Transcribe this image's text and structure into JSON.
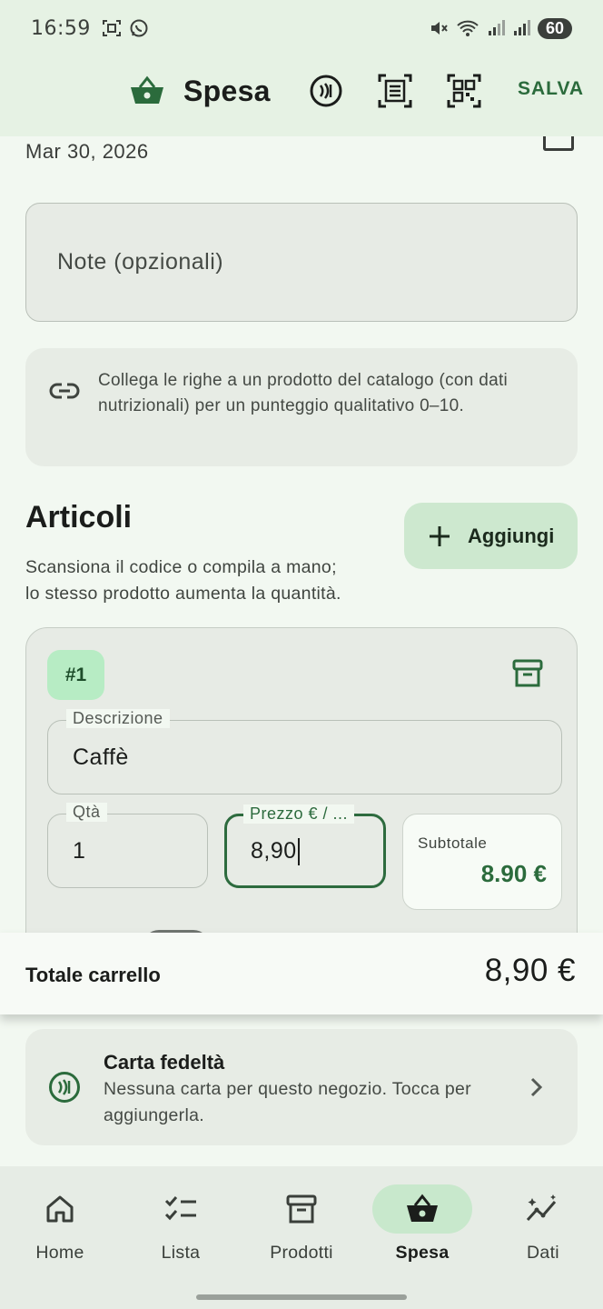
{
  "status_bar": {
    "time": "16:59",
    "battery": "60",
    "icons": [
      "screenshot-icon",
      "whatsapp-icon",
      "mute-icon",
      "wifi-icon",
      "signal-icon",
      "signal-icon"
    ]
  },
  "app_bar": {
    "title": "Spesa",
    "icon": "basket-icon",
    "actions": [
      "nfc-card-icon",
      "receipt-scan-icon",
      "qr-scan-icon"
    ],
    "save_label": "SALVA"
  },
  "form": {
    "date": "Mar 30, 2026",
    "notes_placeholder": "Note (opzionali)"
  },
  "info": {
    "icon": "link-icon",
    "text": "Collega le righe a un prodotto del catalogo (con dati nutrizionali) per un punteggio qualitativo 0–10."
  },
  "articles": {
    "title": "Articoli",
    "subtitle_line1": "Scansiona il codice o compila a mano;",
    "subtitle_line2": "lo stesso prodotto aumenta la quantità.",
    "add_label": "Aggiungi",
    "items": [
      {
        "badge": "#1",
        "description_label": "Descrizione",
        "description": "Caffè",
        "qty_label": "Qtà",
        "qty": "1",
        "price_label": "Prezzo € / ...",
        "price": "8,90",
        "subtotal_label": "Subtotale",
        "subtotal": "8.90 €"
      }
    ]
  },
  "total": {
    "label": "Totale carrello",
    "value": "8,90 €"
  },
  "loyalty": {
    "title": "Carta fedeltà",
    "subtitle": "Nessuna carta per questo negozio. Tocca per aggiungerla."
  },
  "bottom_nav": {
    "items": [
      {
        "label": "Home",
        "icon": "home-icon",
        "active": false
      },
      {
        "label": "Lista",
        "icon": "checklist-icon",
        "active": false
      },
      {
        "label": "Prodotti",
        "icon": "archive-icon",
        "active": false
      },
      {
        "label": "Spesa",
        "icon": "basket-icon",
        "active": true
      },
      {
        "label": "Dati",
        "icon": "insights-icon",
        "active": false
      }
    ]
  },
  "colors": {
    "accent": "#2b6b3c",
    "surface": "#f2f8f1",
    "app_bar": "#e6f2e4",
    "badge": "#b7ecc4",
    "nav_active": "#c8e8cc"
  }
}
